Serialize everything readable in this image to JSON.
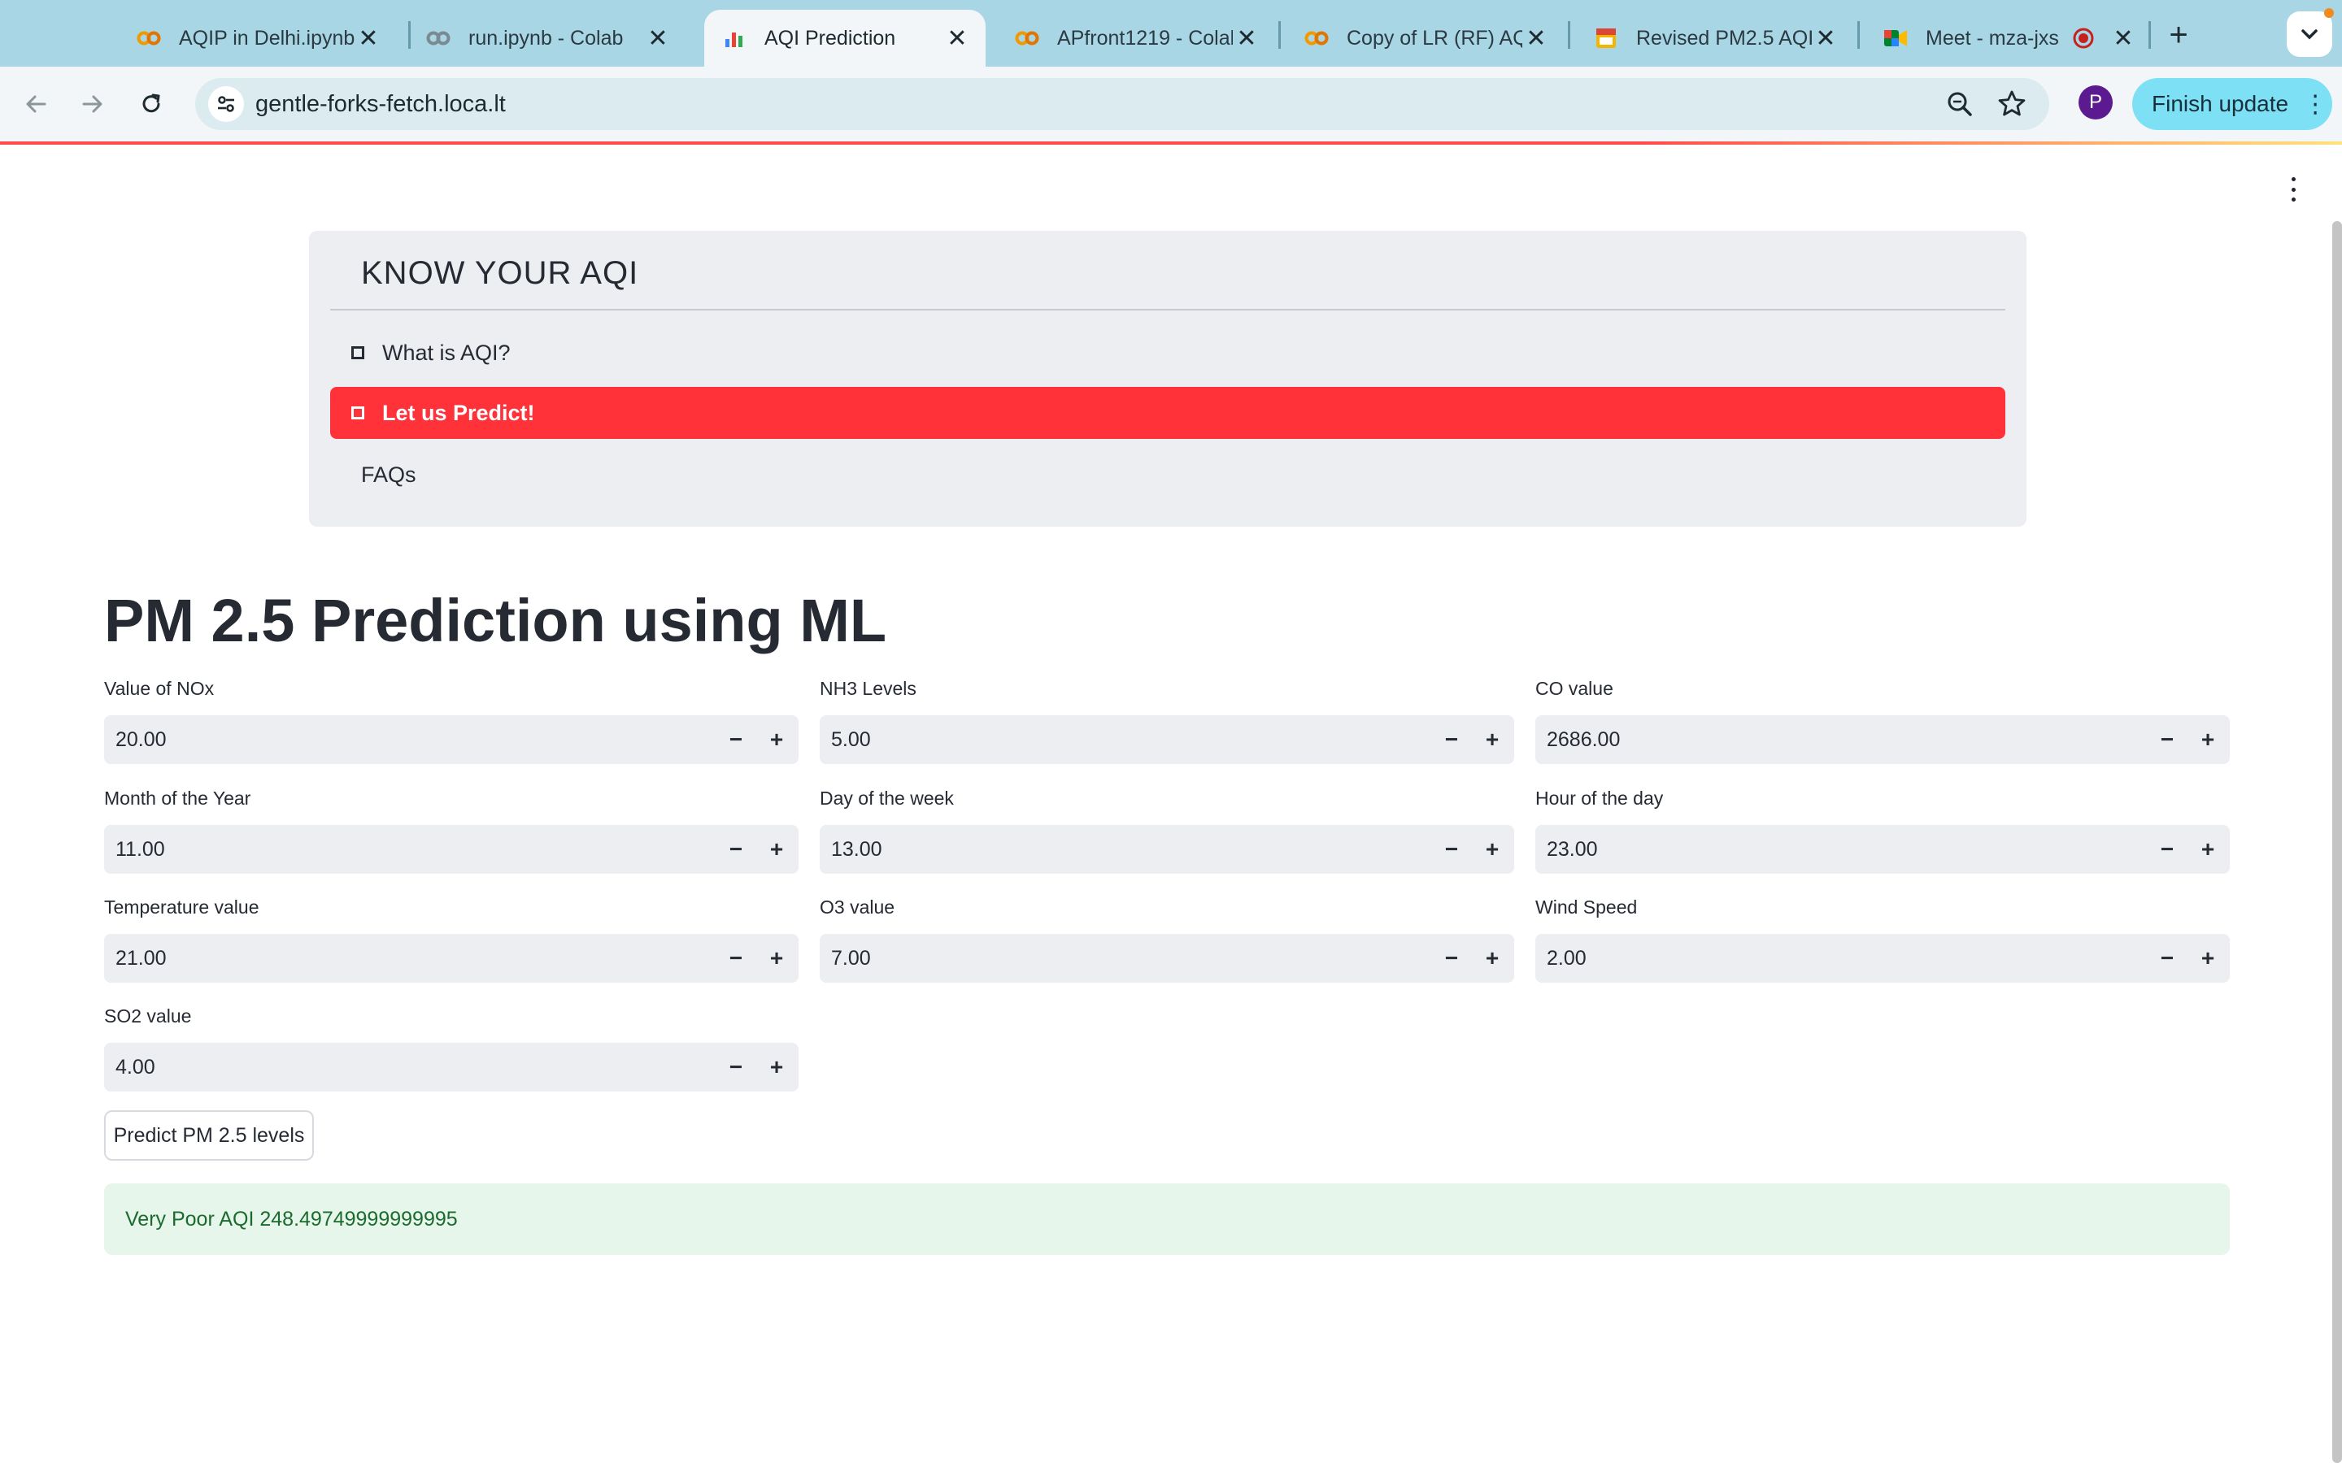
{
  "browser": {
    "tabs": [
      {
        "title": "AQIP in Delhi.ipynb",
        "icon": "colab-icon",
        "active": false
      },
      {
        "title": "run.ipynb - Colab",
        "icon": "colab-icon",
        "active": false
      },
      {
        "title": "AQI Prediction",
        "icon": "streamlit-chart-icon",
        "active": true
      },
      {
        "title": "APfront1219 - Colab",
        "icon": "colab-icon",
        "active": false
      },
      {
        "title": "Copy of LR (RF) AQI",
        "icon": "colab-icon",
        "active": false
      },
      {
        "title": "Revised PM2.5 AQI",
        "icon": "slides-icon",
        "active": false
      },
      {
        "title": "Meet - mza-jxs",
        "icon": "meet-icon",
        "active": false,
        "recording": true
      }
    ],
    "url": "gentle-forks-fetch.loca.lt",
    "profile_initial": "P",
    "finish_update_label": "Finish update",
    "colors": {
      "tabstrip": "#a9d6e5",
      "finish_button": "#7ee0f5",
      "profile": "#5b1a8f"
    }
  },
  "nav": {
    "brand": "KNOW YOUR AQI",
    "items": [
      {
        "label": "What is AQI?",
        "selected": false,
        "checkbox": true
      },
      {
        "label": "Let us Predict!",
        "selected": true,
        "checkbox": true
      },
      {
        "label": "FAQs",
        "selected": false,
        "checkbox": false
      }
    ],
    "colors": {
      "selected": "#ff323a"
    }
  },
  "main": {
    "title": "PM 2.5 Prediction using ML",
    "fields": [
      {
        "label": "Value of NOx",
        "value": "20.00"
      },
      {
        "label": "NH3 Levels",
        "value": "5.00"
      },
      {
        "label": "CO value",
        "value": "2686.00"
      },
      {
        "label": "Month of the Year",
        "value": "11.00"
      },
      {
        "label": "Day of the week",
        "value": "13.00"
      },
      {
        "label": "Hour of the day",
        "value": "23.00"
      },
      {
        "label": "Temperature value",
        "value": "21.00"
      },
      {
        "label": "O3 value",
        "value": "7.00"
      },
      {
        "label": "Wind Speed",
        "value": "2.00"
      },
      {
        "label": "SO2 value",
        "value": "4.00"
      }
    ],
    "stepper": {
      "minus": "−",
      "plus": "+"
    },
    "predict_button": "Predict PM 2.5 levels",
    "result": "Very Poor AQI 248.49749999999995",
    "colors": {
      "result_bg": "#e7f6ea",
      "result_text": "#1c6b2e"
    }
  }
}
